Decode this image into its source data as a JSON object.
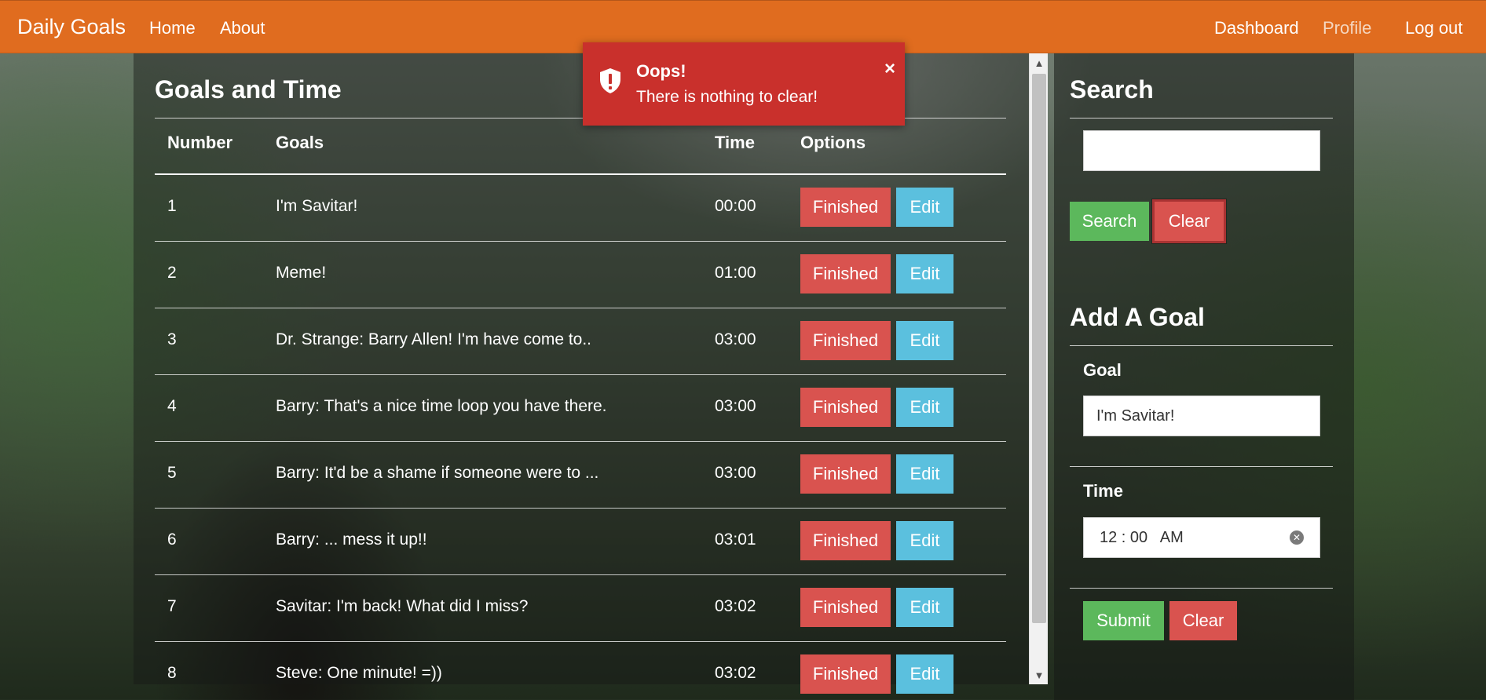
{
  "navbar": {
    "brand": "Daily Goals",
    "links": [
      "Home",
      "About"
    ],
    "right_links": [
      "Dashboard",
      "Profile",
      "Log out"
    ],
    "bg_color": "#e06c1f"
  },
  "goals": {
    "title": "Goals and Time",
    "headers": [
      "Number",
      "Goals",
      "Time",
      "Options"
    ],
    "rows": [
      {
        "number": "1",
        "goal": "I'm Savitar!",
        "time": "00:00"
      },
      {
        "number": "2",
        "goal": "Meme!",
        "time": "01:00"
      },
      {
        "number": "3",
        "goal": "Dr. Strange: Barry Allen! I'm have come to..",
        "time": "03:00"
      },
      {
        "number": "4",
        "goal": "Barry: That's a nice time loop you have there.",
        "time": "03:00"
      },
      {
        "number": "5",
        "goal": "Barry: It'd be a shame if someone were to ...",
        "time": "03:00"
      },
      {
        "number": "6",
        "goal": "Barry: ... mess it up!!",
        "time": "03:01"
      },
      {
        "number": "7",
        "goal": "Savitar: I'm back! What did I miss?",
        "time": "03:02"
      },
      {
        "number": "8",
        "goal": "Steve: One minute! =))",
        "time": "03:02"
      }
    ],
    "finished_label": "Finished",
    "edit_label": "Edit"
  },
  "search": {
    "title": "Search",
    "value": "",
    "search_button": "Search",
    "clear_button": "Clear"
  },
  "add_goal": {
    "title": "Add A Goal",
    "goal_label": "Goal",
    "goal_value": "I'm Savitar!",
    "time_label": "Time",
    "time_value": "12 : 00   AM",
    "submit_button": "Submit",
    "clear_button": "Clear"
  },
  "toast": {
    "title": "Oops!",
    "message": "There is nothing to clear!",
    "close": "×",
    "icon": "shield-exclamation-icon",
    "bg_color": "#c9302c"
  }
}
